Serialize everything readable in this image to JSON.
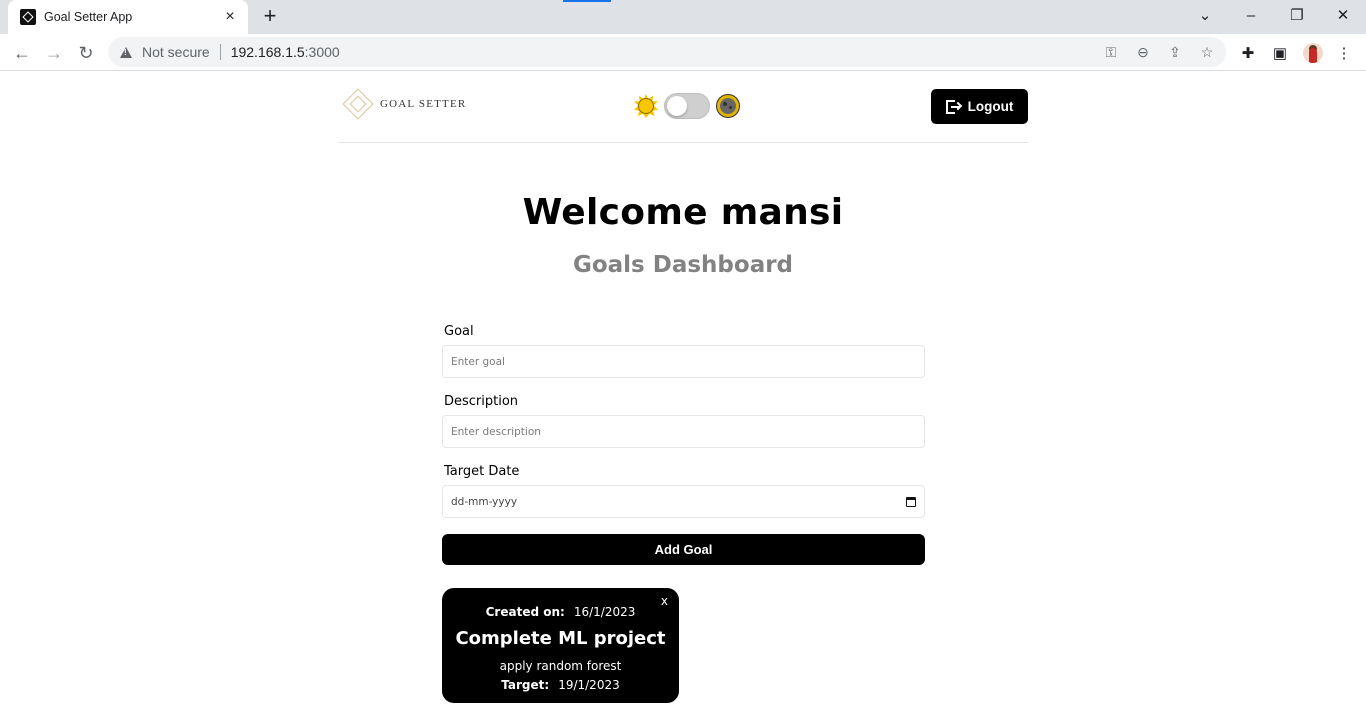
{
  "browser": {
    "tab_title": "Goal Setter App",
    "security_label": "Not secure",
    "url_host": "192.168.1.5",
    "url_port": ":3000"
  },
  "header": {
    "logo_text": "GOAL SETTER",
    "logout_label": "Logout"
  },
  "main": {
    "welcome": "Welcome mansi",
    "subtitle": "Goals Dashboard"
  },
  "form": {
    "goal_label": "Goal",
    "goal_placeholder": "Enter goal",
    "description_label": "Description",
    "description_placeholder": "Enter description",
    "date_label": "Target Date",
    "date_placeholder": "dd-mm-yyyy",
    "submit_label": "Add Goal"
  },
  "goals": [
    {
      "created_label": "Created on:",
      "created_date": "16/1/2023",
      "title": "Complete ML project",
      "description": "apply random forest",
      "target_label": "Target:",
      "target_date": "19/1/2023",
      "close_label": "x"
    }
  ],
  "colors": {
    "primary": "#000000",
    "subtitle": "#828282",
    "logo_accent": "#d8c59a",
    "sun": "#f7c600"
  }
}
